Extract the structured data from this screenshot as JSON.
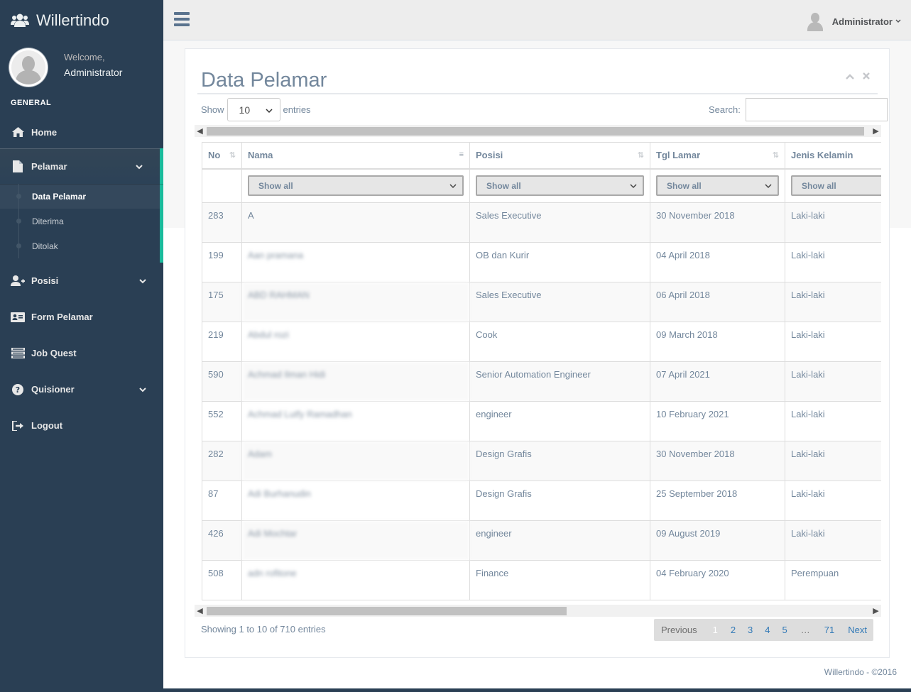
{
  "app": {
    "brand": "Willertindo"
  },
  "profile": {
    "welcome": "Welcome,",
    "name": "Administrator"
  },
  "sidebar": {
    "section": "GENERAL",
    "items": [
      {
        "label": "Home",
        "icon": "home-icon"
      },
      {
        "label": "Pelamar",
        "icon": "file-icon",
        "children": [
          "Data Pelamar",
          "Diterima",
          "Ditolak"
        ]
      },
      {
        "label": "Posisi",
        "icon": "user-plus-icon"
      },
      {
        "label": "Form Pelamar",
        "icon": "id-card-icon"
      },
      {
        "label": "Job Quest",
        "icon": "list-icon"
      },
      {
        "label": "Quisioner",
        "icon": "question-icon"
      },
      {
        "label": "Logout",
        "icon": "sign-out-icon"
      }
    ]
  },
  "topbar": {
    "user": "Administrator"
  },
  "panel": {
    "title": "Data Pelamar",
    "length": {
      "show": "Show",
      "value": "10",
      "entries": "entries"
    },
    "search_label": "Search:"
  },
  "table": {
    "columns": [
      "No",
      "Nama",
      "Posisi",
      "Tgl Lamar",
      "Jenis Kelamin"
    ],
    "filter_label": "Show all",
    "rows": [
      {
        "no": "283",
        "nama": "A",
        "posisi": "Sales Executive",
        "tgl": "30 November 2018",
        "jk": "Laki-laki"
      },
      {
        "no": "199",
        "nama": "Aan pramana",
        "posisi": "OB dan Kurir",
        "tgl": "04 April 2018",
        "jk": "Laki-laki"
      },
      {
        "no": "175",
        "nama": "ABD RAHMAN",
        "posisi": "Sales Executive",
        "tgl": "06 April 2018",
        "jk": "Laki-laki"
      },
      {
        "no": "219",
        "nama": "Abdul rozi",
        "posisi": "Cook",
        "tgl": "09 March 2018",
        "jk": "Laki-laki"
      },
      {
        "no": "590",
        "nama": "Achmad Ilman Hidi",
        "posisi": "Senior Automation Engineer",
        "tgl": "07 April 2021",
        "jk": "Laki-laki"
      },
      {
        "no": "552",
        "nama": "Achmad Lutfy Ramadhan",
        "posisi": "engineer",
        "tgl": "10 February 2021",
        "jk": "Laki-laki"
      },
      {
        "no": "282",
        "nama": "Adam",
        "posisi": "Design Grafis",
        "tgl": "30 November 2018",
        "jk": "Laki-laki"
      },
      {
        "no": "87",
        "nama": "Adi Burhanudin",
        "posisi": "Design Grafis",
        "tgl": "25 September 2018",
        "jk": "Laki-laki"
      },
      {
        "no": "426",
        "nama": "Adi Mochtar",
        "posisi": "engineer",
        "tgl": "09 August 2019",
        "jk": "Laki-laki"
      },
      {
        "no": "508",
        "nama": "adn rofitone",
        "posisi": "Finance",
        "tgl": "04 February 2020",
        "jk": "Perempuan"
      }
    ]
  },
  "info": "Showing 1 to 10 of 710 entries",
  "pagination": {
    "previous": "Previous",
    "pages": [
      "1",
      "2",
      "3",
      "4",
      "5",
      "…",
      "71"
    ],
    "next": "Next",
    "current": "1"
  },
  "footer": "Willertindo - ©2016",
  "colors": {
    "sidebar": "#2A3F54",
    "accent": "#1ABB9C",
    "text": "#73879C",
    "link": "#337AB7"
  }
}
